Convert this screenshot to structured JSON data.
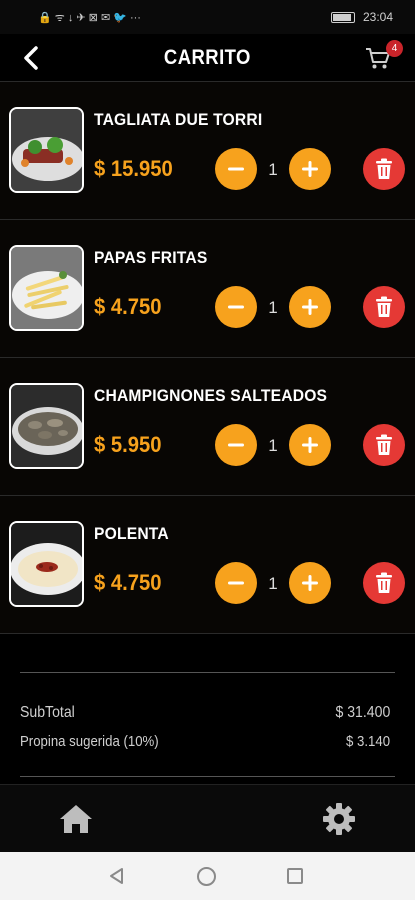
{
  "status_bar": {
    "icons": "🔒 ᯤ ↓ ✈ ⊠ ✉ 🐦 ···",
    "time": "23:04"
  },
  "header": {
    "title": "CARRITO",
    "cart_count": "4",
    "back_icon": "chevron-left-icon",
    "cart_icon": "shopping-cart-icon"
  },
  "items": [
    {
      "name": "TAGLIATA DUE TORRI",
      "price": "$ 15.950",
      "qty": "1"
    },
    {
      "name": "PAPAS FRITAS",
      "price": "$ 4.750",
      "qty": "1"
    },
    {
      "name": "CHAMPIGNONES SALTEADOS",
      "price": "$ 5.950",
      "qty": "1"
    },
    {
      "name": "POLENTA",
      "price": "$ 4.750",
      "qty": "1"
    }
  ],
  "totals": {
    "subtotal_label": "SubTotal",
    "subtotal_value": "$ 31.400",
    "tip_label": "Propina sugerida (10%)",
    "tip_value": "$ 3.140"
  },
  "colors": {
    "accent": "#f7a21d",
    "delete": "#e53935",
    "badge": "#c9242a",
    "background": "#000000"
  }
}
